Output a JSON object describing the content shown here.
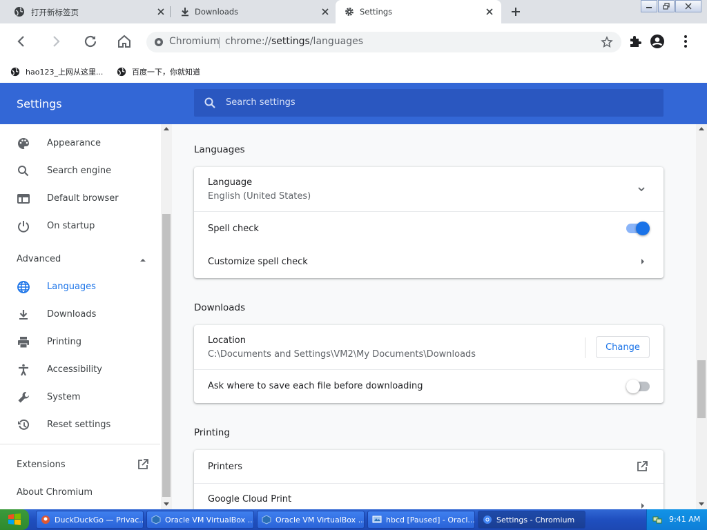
{
  "tabs": [
    {
      "label": "打开新标签页",
      "icon": "globe-icon"
    },
    {
      "label": "Downloads",
      "icon": "download-icon"
    },
    {
      "label": "Settings",
      "icon": "gear-icon",
      "active": true
    }
  ],
  "omnibox": {
    "origin": "Chromium",
    "url_scheme": "chrome://",
    "url_host": "settings",
    "url_path": "/languages"
  },
  "bookmarks": [
    {
      "label": "hao123_上网从这里...",
      "icon": "globe-icon"
    },
    {
      "label": "百度一下，你就知道",
      "icon": "globe-icon"
    }
  ],
  "header": {
    "title": "Settings",
    "search_placeholder": "Search settings"
  },
  "sidebar": {
    "items": [
      {
        "label": "Appearance",
        "icon": "palette-icon"
      },
      {
        "label": "Search engine",
        "icon": "search-icon"
      },
      {
        "label": "Default browser",
        "icon": "browser-icon"
      },
      {
        "label": "On startup",
        "icon": "power-icon"
      }
    ],
    "advanced_label": "Advanced",
    "advanced_items": [
      {
        "label": "Languages",
        "icon": "globe-icon",
        "active": true
      },
      {
        "label": "Downloads",
        "icon": "download-icon"
      },
      {
        "label": "Printing",
        "icon": "printer-icon"
      },
      {
        "label": "Accessibility",
        "icon": "accessibility-icon"
      },
      {
        "label": "System",
        "icon": "wrench-icon"
      },
      {
        "label": "Reset settings",
        "icon": "history-icon"
      }
    ],
    "extensions_label": "Extensions",
    "about_label": "About Chromium"
  },
  "main": {
    "languages": {
      "title": "Languages",
      "language_label": "Language",
      "language_value": "English (United States)",
      "spell_check_label": "Spell check",
      "spell_check_on": true,
      "customize_label": "Customize spell check"
    },
    "downloads": {
      "title": "Downloads",
      "location_label": "Location",
      "location_value": "C:\\Documents and Settings\\VM2\\My Documents\\Downloads",
      "change_button": "Change",
      "ask_label": "Ask where to save each file before downloading",
      "ask_on": false
    },
    "printing": {
      "title": "Printing",
      "printers_label": "Printers",
      "cloud_print_label": "Google Cloud Print"
    }
  },
  "taskbar": {
    "tasks": [
      {
        "label": "DuckDuckGo — Privac...",
        "icon": "duckduckgo-icon"
      },
      {
        "label": "Oracle VM VirtualBox ...",
        "icon": "virtualbox-icon"
      },
      {
        "label": "Oracle VM VirtualBox ...",
        "icon": "virtualbox-icon"
      },
      {
        "label": "hbcd [Paused] - Oracl...",
        "icon": "vm-icon"
      },
      {
        "label": "Settings - Chromium",
        "icon": "chromium-icon",
        "active": true
      }
    ],
    "clock": "9:41 AM"
  },
  "colors": {
    "accent": "#1a73e8",
    "header": "#3367d6",
    "search_bg": "#2a57c0",
    "taskbar": "#245edb"
  }
}
